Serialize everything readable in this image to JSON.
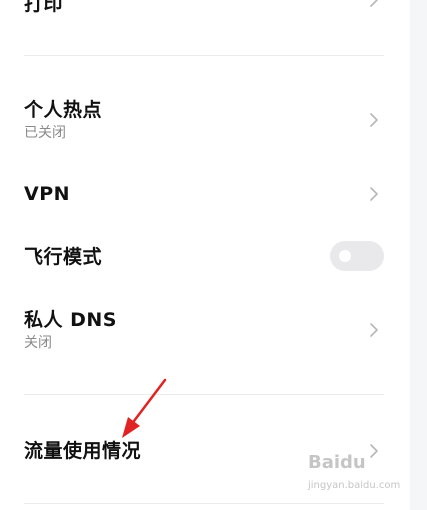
{
  "settings": {
    "print": {
      "title": "打印"
    },
    "hotspot": {
      "title": "个人热点",
      "status": "已关闭"
    },
    "vpn": {
      "title": "VPN"
    },
    "airplane": {
      "title": "飞行模式",
      "enabled": false
    },
    "private_dns": {
      "title": "私人 DNS",
      "status": "关闭"
    },
    "data_usage": {
      "title": "流量使用情况"
    }
  },
  "watermark": {
    "main": "Baidu",
    "sub": "jingyan.baidu.com"
  },
  "colors": {
    "annotation_arrow": "#e02424"
  }
}
